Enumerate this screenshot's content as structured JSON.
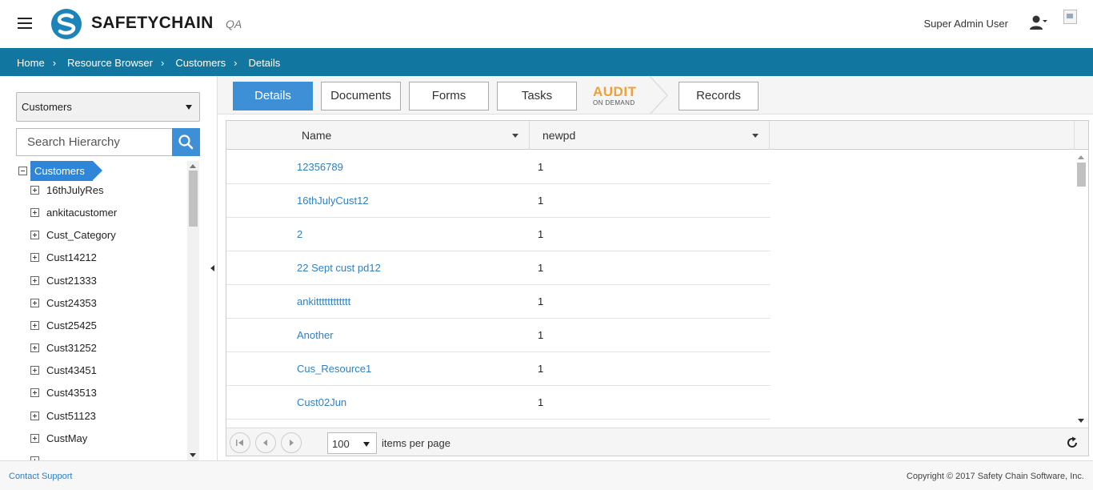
{
  "header": {
    "brand": "SAFETYCHAIN",
    "environment": "QA",
    "user_name": "Super Admin User",
    "brand_color": "#1c84b8"
  },
  "breadcrumb": [
    "Home",
    "Resource Browser",
    "Customers",
    "Details"
  ],
  "sidebar": {
    "selected_type": "Customers",
    "search_placeholder": "Search Hierarchy",
    "tree_root": "Customers",
    "tree_items": [
      "16thJulyRes",
      "ankitacustomer",
      "Cust_Category",
      "Cust14212",
      "Cust21333",
      "Cust24353",
      "Cust25425",
      "Cust31252",
      "Cust43451",
      "Cust43513",
      "Cust51123",
      "CustMay"
    ]
  },
  "tabs": {
    "details": "Details",
    "documents": "Documents",
    "forms": "Forms",
    "tasks": "Tasks",
    "audit_top": "AUDIT",
    "audit_bottom": "ON DEMAND",
    "records": "Records"
  },
  "grid": {
    "columns": [
      "Name",
      "newpd"
    ],
    "rows": [
      {
        "name": "12356789",
        "newpd": "1"
      },
      {
        "name": "16thJulyCust12",
        "newpd": "1"
      },
      {
        "name": "2",
        "newpd": "1"
      },
      {
        "name": "22 Sept cust pd12",
        "newpd": "1"
      },
      {
        "name": "ankitttttttttttt",
        "newpd": "1"
      },
      {
        "name": "Another",
        "newpd": "1"
      },
      {
        "name": "Cus_Resource1",
        "newpd": "1"
      },
      {
        "name": "Cust02Jun",
        "newpd": "1"
      }
    ]
  },
  "pager": {
    "page_size": "100",
    "label": "items per page"
  },
  "footer": {
    "contact": "Contact Support",
    "copyright": "Copyright © 2017 Safety Chain Software, Inc."
  },
  "colors": {
    "accent": "#3d8fd6",
    "breadcrumb_bar": "#1277a0",
    "audit_orange": "#f0a03a",
    "link": "#2f7fc4"
  }
}
